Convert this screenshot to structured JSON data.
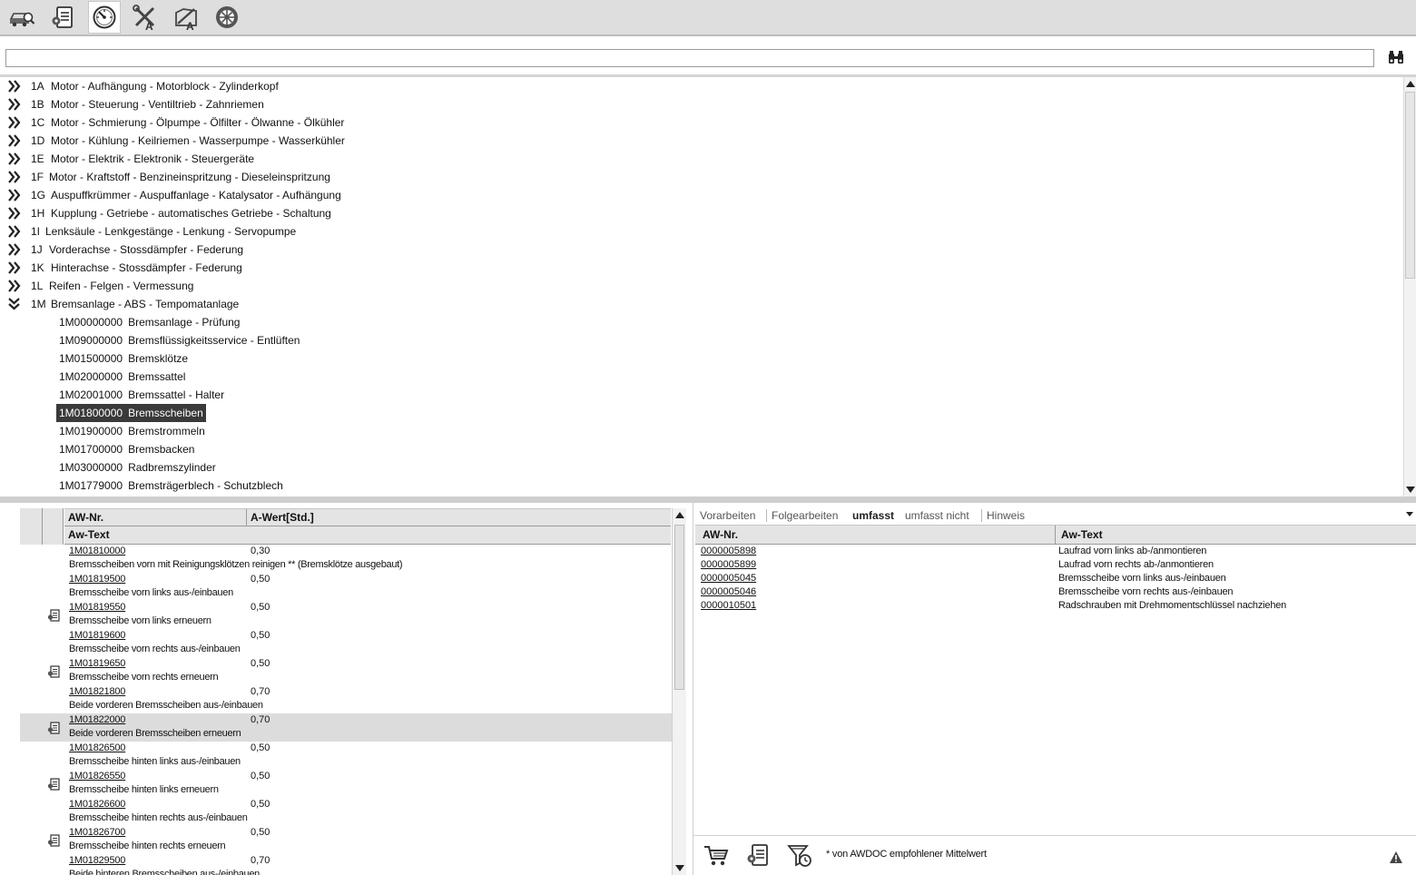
{
  "toolbar": {
    "icons": [
      "vehicle-search-icon",
      "worklist-icon",
      "gauge-icon",
      "tools-text-icon",
      "repair-text-icon",
      "wheel-icon"
    ],
    "active_index": 2
  },
  "search": {
    "value": "",
    "placeholder": ""
  },
  "tree": {
    "groups": [
      {
        "code": "1A",
        "title": "Motor - Aufhängung - Motorblock - Zylinderkopf"
      },
      {
        "code": "1B",
        "title": "Motor - Steuerung - Ventiltrieb - Zahnriemen"
      },
      {
        "code": "1C",
        "title": "Motor - Schmierung - Ölpumpe - Ölfilter - Ölwanne - Ölkühler"
      },
      {
        "code": "1D",
        "title": "Motor - Kühlung - Keilriemen - Wasserpumpe - Wasserkühler"
      },
      {
        "code": "1E",
        "title": "Motor - Elektrik - Elektronik - Steuergeräte"
      },
      {
        "code": "1F",
        "title": "Motor - Kraftstoff - Benzineinspritzung - Dieseleinspritzung"
      },
      {
        "code": "1G",
        "title": "Auspuffkrümmer - Auspuffanlage - Katalysator - Aufhängung"
      },
      {
        "code": "1H",
        "title": "Kupplung - Getriebe - automatisches Getriebe - Schaltung"
      },
      {
        "code": "1I",
        "title": "Lenksäule - Lenkgestänge - Lenkung - Servopumpe"
      },
      {
        "code": "1J",
        "title": "Vorderachse - Stossdämpfer - Federung"
      },
      {
        "code": "1K",
        "title": "Hinterachse - Stossdämpfer - Federung"
      },
      {
        "code": "1L",
        "title": "Reifen - Felgen - Vermessung"
      },
      {
        "code": "1M",
        "title": "Bremsanlage - ABS - Tempomatanlage",
        "expanded": true
      }
    ],
    "children": [
      {
        "code": "1M00000000",
        "title": "Bremsanlage - Prüfung"
      },
      {
        "code": "1M09000000",
        "title": "Bremsflüssigkeitsservice - Entlüften"
      },
      {
        "code": "1M01500000",
        "title": "Bremsklötze"
      },
      {
        "code": "1M02000000",
        "title": "Bremssattel"
      },
      {
        "code": "1M02001000",
        "title": "Bremssattel - Halter"
      },
      {
        "code": "1M01800000",
        "title": "Bremsscheiben",
        "selected": true
      },
      {
        "code": "1M01900000",
        "title": "Bremstrommeln"
      },
      {
        "code": "1M01700000",
        "title": "Bremsbacken"
      },
      {
        "code": "1M03000000",
        "title": "Radbremszylinder"
      },
      {
        "code": "1M01779000",
        "title": "Bremsträgerblech - Schutzblech"
      }
    ]
  },
  "left_grid": {
    "headers": {
      "aw_nr": "AW-Nr.",
      "a_wert": "A-Wert[Std.]",
      "aw_text": "Aw-Text"
    },
    "rows": [
      {
        "nr": "1M01810000",
        "val": "0,30",
        "text": "Bremsscheiben vorn mit Reinigungsklötzen reinigen ** (Bremsklötze ausgebaut)",
        "doc": false
      },
      {
        "nr": "1M01819500",
        "val": "0,50",
        "text": "Bremsscheibe vorn links aus-/einbauen",
        "doc": false
      },
      {
        "nr": "1M01819550",
        "val": "0,50",
        "text": "Bremsscheibe vorn links erneuern",
        "doc": true
      },
      {
        "nr": "1M01819600",
        "val": "0,50",
        "text": "Bremsscheibe vorn rechts aus-/einbauen",
        "doc": false
      },
      {
        "nr": "1M01819650",
        "val": "0,50",
        "text": "Bremsscheibe vorn rechts erneuern",
        "doc": true
      },
      {
        "nr": "1M01821800",
        "val": "0,70",
        "text": "Beide vorderen Bremsscheiben aus-/einbauen",
        "doc": false
      },
      {
        "nr": "1M01822000",
        "val": "0,70",
        "text": "Beide vorderen Bremsscheiben erneuern",
        "doc": true,
        "highlight": true
      },
      {
        "nr": "1M01826500",
        "val": "0,50",
        "text": "Bremsscheibe hinten links aus-/einbauen",
        "doc": false
      },
      {
        "nr": "1M01826550",
        "val": "0,50",
        "text": "Bremsscheibe hinten links erneuern",
        "doc": true
      },
      {
        "nr": "1M01826600",
        "val": "0,50",
        "text": "Bremsscheibe hinten rechts aus-/einbauen",
        "doc": false
      },
      {
        "nr": "1M01826700",
        "val": "0,50",
        "text": "Bremsscheibe hinten rechts erneuern",
        "doc": true
      },
      {
        "nr": "1M01829500",
        "val": "0,70",
        "text": "Beide hinteren Bremsscheiben aus-/einbauen",
        "doc": false
      }
    ]
  },
  "right_panel": {
    "tabs": [
      {
        "label": "Vorarbeiten"
      },
      {
        "label": "Folgearbeiten"
      },
      {
        "label": "umfasst",
        "active": true
      },
      {
        "label": "umfasst nicht"
      },
      {
        "label": "Hinweis"
      }
    ],
    "headers": {
      "aw_nr": "AW-Nr.",
      "aw_text": "Aw-Text"
    },
    "rows": [
      {
        "nr": "0000005898",
        "text": "Laufrad vorn links ab-/anmontieren"
      },
      {
        "nr": "0000005899",
        "text": "Laufrad vorn rechts ab-/anmontieren"
      },
      {
        "nr": "0000005045",
        "text": "Bremsscheibe vorn links aus-/einbauen"
      },
      {
        "nr": "0000005046",
        "text": "Bremsscheibe vorn rechts aus-/einbauen"
      },
      {
        "nr": "0000010501",
        "text": "Radschrauben mit Drehmomentschlüssel nachziehen"
      }
    ],
    "footer_note": "* von AWDOC empfohlener Mittelwert",
    "footer_icons": [
      "cart-icon",
      "worklist-icon",
      "filter-clock-icon",
      "warning-icon"
    ]
  }
}
